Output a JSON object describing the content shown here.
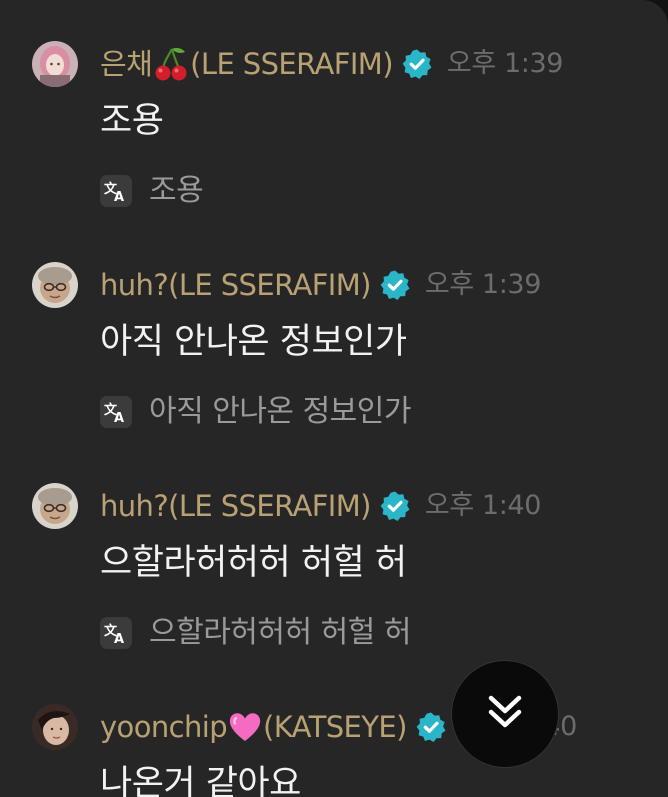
{
  "messages": [
    {
      "username": "은채",
      "group": "(LE SSERAFIM)",
      "emoji_icon": "cherry-icon",
      "verified": true,
      "time": "오후 1:39",
      "text": "조용",
      "translation": "조용"
    },
    {
      "username": "huh?(LE SSERAFIM)",
      "verified": true,
      "time": "오후 1:39",
      "text": "아직 안나온 정보인가",
      "translation": "아직 안나온 정보인가"
    },
    {
      "username": "huh?(LE SSERAFIM)",
      "verified": true,
      "time": "오후 1:40",
      "text": "으할라허허허 허헐 허",
      "translation": "으할라허허허 허헐 허"
    },
    {
      "username": "yoonchip",
      "group": "(KATSEYE)",
      "emoji_icon": "pink-heart-icon",
      "verified": true,
      "time": "오후 1:40",
      "text": "나온거 같아요"
    }
  ],
  "colors": {
    "background": "#262626",
    "username": "#b8a172",
    "verified": "#2bb5c9",
    "message_text": "#f2f2f2",
    "time_text": "#6c6c6c",
    "translation_text": "#9a9a9a"
  },
  "icons": {
    "verified": "verified-badge-icon",
    "translate": "translate-icon",
    "scroll_to_bottom": "double-chevron-down-icon"
  }
}
